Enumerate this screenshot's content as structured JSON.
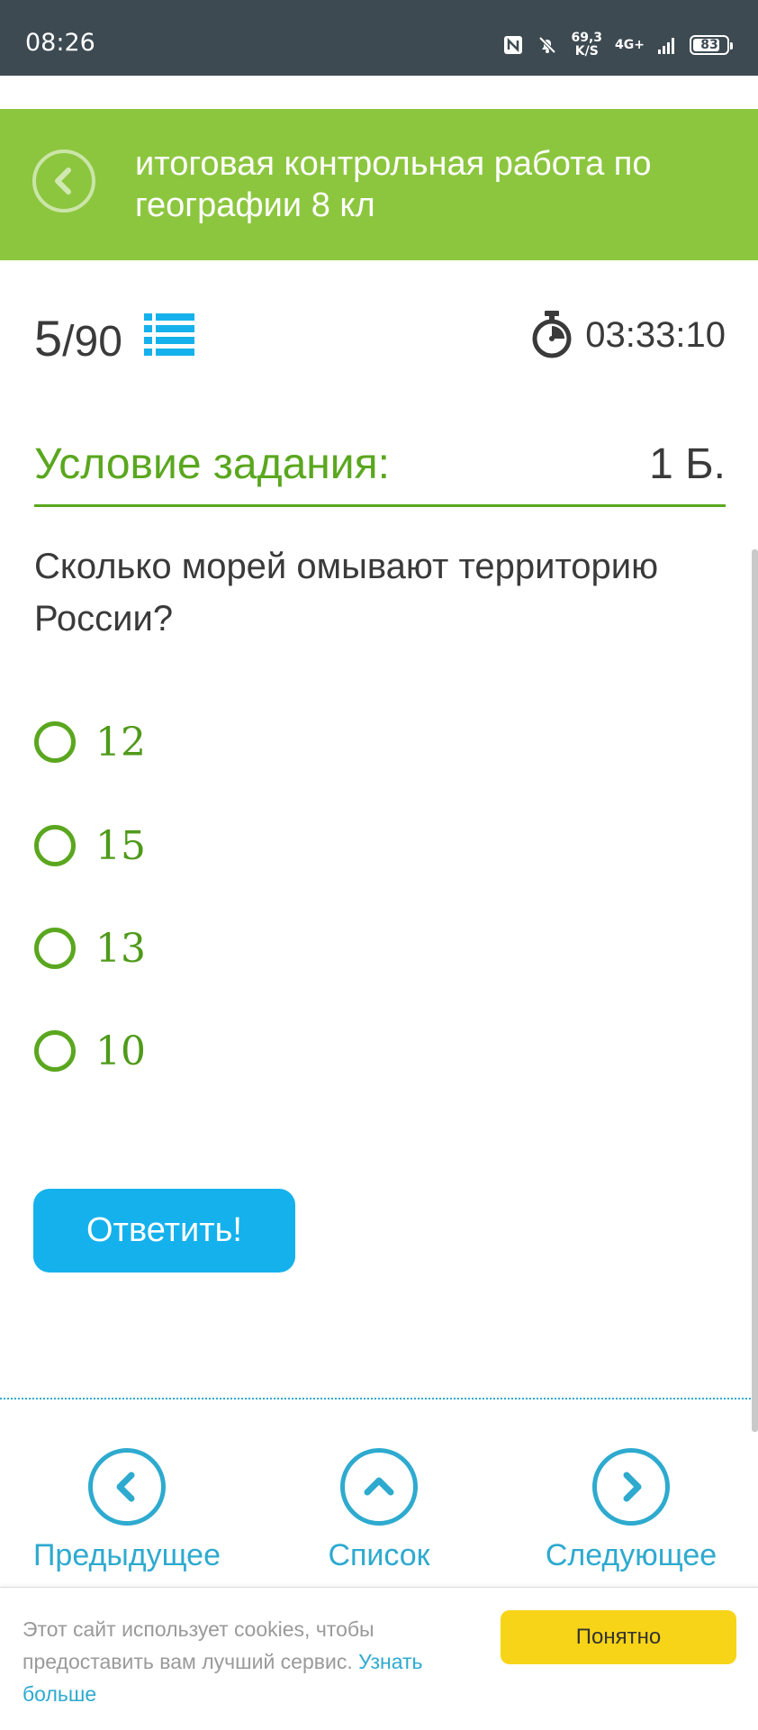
{
  "status_bar": {
    "time": "08:26",
    "speed_value": "69,3",
    "speed_unit": "K/S",
    "network": "4G+",
    "battery": "83",
    "battery_level": 0.83
  },
  "header": {
    "title": "итоговая контрольная работа по географии 8 кл"
  },
  "progress": {
    "current": "5",
    "total": "/90",
    "timer": "03:33:10"
  },
  "task": {
    "heading": "Условие задания:",
    "points": "1 Б.",
    "question": "Сколько морей омывают территорию России?",
    "options": [
      "12",
      "15",
      "13",
      "10"
    ],
    "submit_label": "Ответить!"
  },
  "nav": {
    "prev_label": "Предыдущее",
    "list_label": "Список",
    "next_label": "Следующее"
  },
  "cookie": {
    "text": "Этот сайт использует cookies, чтобы предоставить вам лучший сервис.",
    "link": "Узнать больше",
    "button": "Понятно"
  },
  "colors": {
    "header_green": "#8cc63f",
    "accent_green": "#5aa71f",
    "accent_blue": "#15b1ec",
    "nav_blue": "#2eaacf",
    "cookie_yellow": "#f7d417",
    "status_bar": "#3d4a52"
  }
}
